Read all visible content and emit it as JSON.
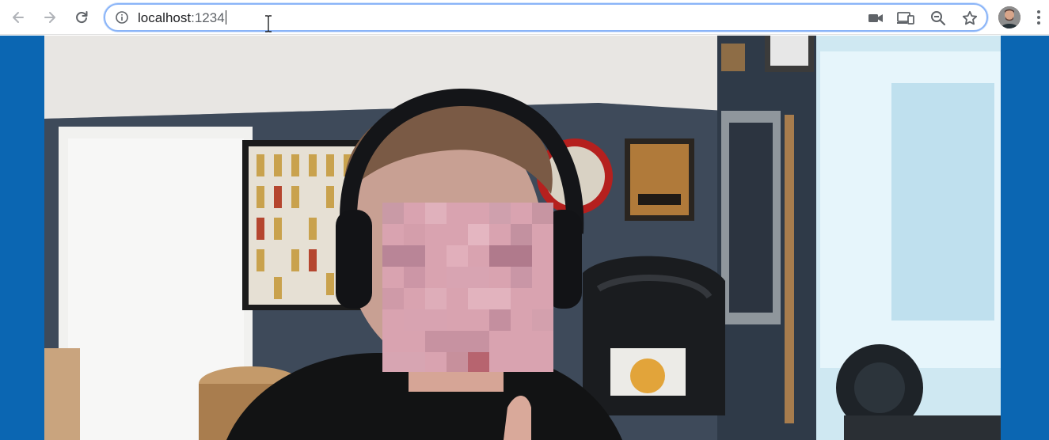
{
  "browser": {
    "url_host": "localhost",
    "url_port": ":1234",
    "icons": {
      "back": "arrow-left-icon",
      "forward": "arrow-right-icon",
      "reload": "reload-icon",
      "site_info": "info-icon",
      "camera": "video-camera-icon",
      "cast": "cast-icon",
      "zoom": "zoom-out-icon",
      "bookmark": "star-icon",
      "menu": "kebab-menu-icon"
    }
  },
  "page": {
    "background_color": "#0b66b2",
    "content": "webcam-video-feed"
  }
}
